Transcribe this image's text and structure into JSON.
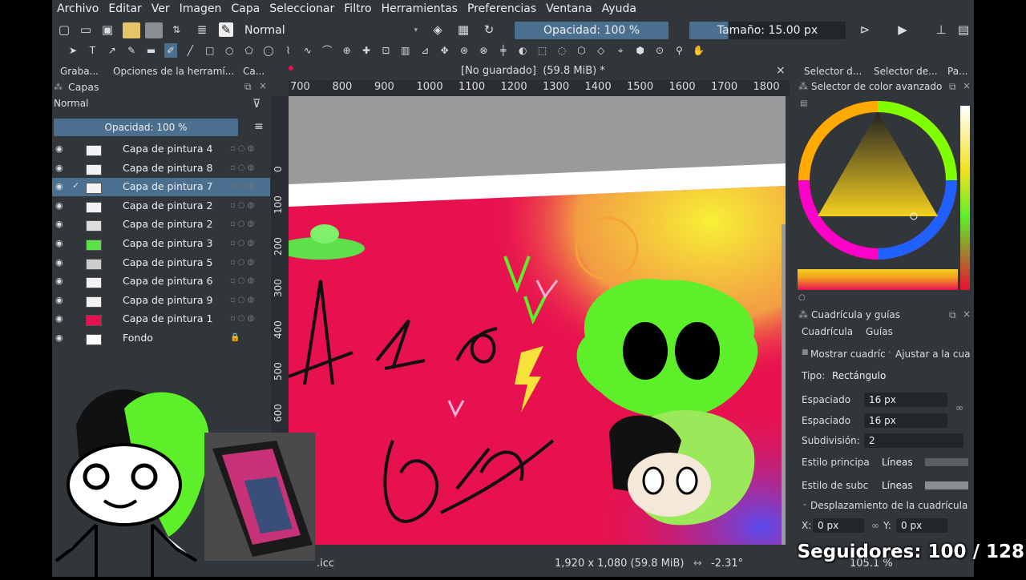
{
  "menu": [
    "Archivo",
    "Editar",
    "Ver",
    "Imagen",
    "Capa",
    "Seleccionar",
    "Filtro",
    "Herramientas",
    "Preferencias",
    "Ventana",
    "Ayuda"
  ],
  "toolbar": {
    "blend_mode": "Normal",
    "opacity": "Opacidad: 100 %",
    "size": "Tamaño: 15.00 px"
  },
  "docker_tabs": [
    "Graba...",
    "Opciones de la herramí...",
    "Ca..."
  ],
  "layers": {
    "title": "Capas",
    "blend_mode": "Normal",
    "opacity": "Opacidad: 100 %",
    "items": [
      {
        "name": "Capa de pintura 4",
        "thumb": "#f2f2f2",
        "selected": false,
        "active": false,
        "locked": false
      },
      {
        "name": "Capa de pintura 8",
        "thumb": "#f2f2f2",
        "selected": false,
        "active": false,
        "locked": false
      },
      {
        "name": "Capa de pintura 7",
        "thumb": "#f2f2f2",
        "selected": true,
        "active": true,
        "locked": false
      },
      {
        "name": "Capa de pintura 2",
        "thumb": "#f2f2f2",
        "selected": false,
        "active": false,
        "locked": false
      },
      {
        "name": "Capa de pintura 2",
        "thumb": "#dddddd",
        "selected": false,
        "active": false,
        "locked": false
      },
      {
        "name": "Capa de pintura 3",
        "thumb": "#5de04a",
        "selected": false,
        "active": false,
        "locked": false
      },
      {
        "name": "Capa de pintura 5",
        "thumb": "#cccccc",
        "selected": false,
        "active": false,
        "locked": false
      },
      {
        "name": "Capa de pintura 6",
        "thumb": "#f2f2f2",
        "selected": false,
        "active": false,
        "locked": false
      },
      {
        "name": "Capa de pintura 9",
        "thumb": "#f2f2f2",
        "selected": false,
        "active": false,
        "locked": false
      },
      {
        "name": "Capa de pintura 1",
        "thumb": "#e8114f",
        "selected": false,
        "active": false,
        "locked": false
      },
      {
        "name": "Fondo",
        "thumb": "#ffffff",
        "selected": false,
        "active": false,
        "locked": true
      }
    ]
  },
  "canvas": {
    "tab_title": "[No guardado]  (59.8 MiB) *",
    "ruler_h": [
      "700",
      "800",
      "900",
      "1000",
      "1100",
      "1200",
      "1300",
      "1400",
      "1500",
      "1600",
      "1700",
      "1800"
    ],
    "ruler_v": [
      "0",
      "100",
      "200",
      "300",
      "400",
      "500",
      "600"
    ]
  },
  "right_docker": {
    "tabs": [
      "Selector d...",
      "Selector de...",
      "Pa..."
    ],
    "color_title": "Selector de color avanzado",
    "grid_title": "Cuadrícula y guías",
    "grid_tabs": [
      "Cuadrícula",
      "Guías"
    ],
    "show_grid": "Mostrar cuadríc",
    "snap_grid": "Ajustar a la cua",
    "type_label": "Tipo:",
    "type_value": "Rectángulo",
    "spacing1_label": "Espaciado",
    "spacing1_value": "16 px",
    "spacing2_label": "Espaciado",
    "spacing2_value": "16 px",
    "subdiv_label": "Subdivisión:",
    "subdiv_value": "2",
    "main_style_label": "Estilo principa",
    "main_style_value": "Líneas",
    "sub_style_label": "Estilo de subc",
    "sub_style_value": "Líneas",
    "offset_label": "Desplazamiento de la cuadrícula",
    "x_label": "X:",
    "x_value": "0 px",
    "y_label": "Y:",
    "y_value": "0 px"
  },
  "status": {
    "profile": ".icc",
    "dimensions": "1,920 x 1,080 (59.8 MiB)",
    "rotation": "-2.31°",
    "zoom": "105.1 %"
  },
  "overlay": {
    "followers": "Seguidores: 100 / 128"
  },
  "colors": {
    "canvas_pink": "#e8114f",
    "accent_green": "#5df02a",
    "panel_bg": "#31363b",
    "highlight": "#4a6f8f"
  }
}
